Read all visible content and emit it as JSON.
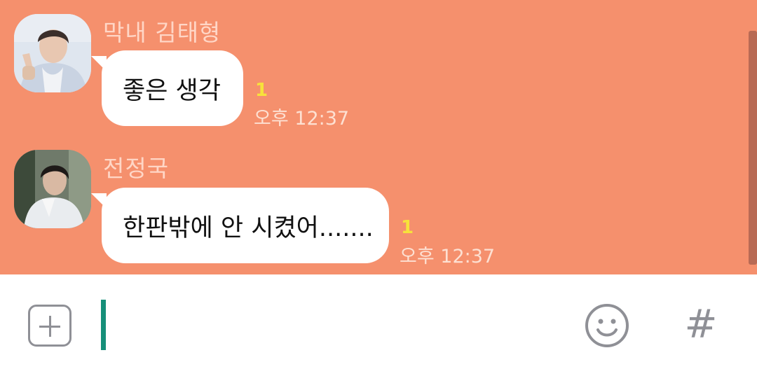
{
  "messages": [
    {
      "sender": "막내 김태형",
      "text": "좋은 생각",
      "unread": "1",
      "time": "오후 12:37"
    },
    {
      "sender": "전정국",
      "text": "한판밖에 안 시켰어.......",
      "unread": "1",
      "time": "오후 12:37"
    }
  ],
  "input": {
    "value": "",
    "add_icon": "plus-square-icon",
    "emoji_icon": "smiley-icon",
    "hash_icon": "#"
  },
  "colors": {
    "chat_background": "#f5906d",
    "bubble": "#ffffff",
    "unread": "#f7e23b",
    "cursor": "#168f79",
    "icon": "#8f9096"
  }
}
